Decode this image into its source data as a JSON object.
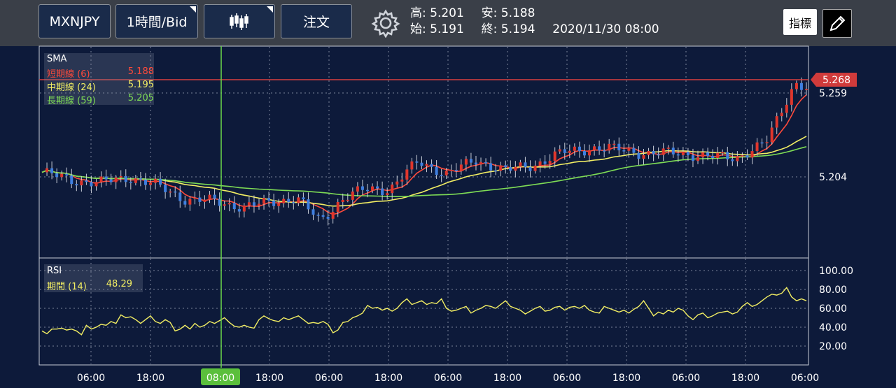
{
  "toolbar": {
    "symbol_label": "MXNJPY",
    "timeframe_label": "1時間/Bid",
    "order_label": "注文",
    "indicator_label": "指標",
    "settings_icon": "gear-icon",
    "candles_icon": "candlestick-icon",
    "draw_icon": "pencil-icon"
  },
  "ohlc": {
    "high_label": "高:",
    "high": "5.201",
    "low_label": "安:",
    "low": "5.188",
    "open_label": "始:",
    "open": "5.191",
    "close_label": "終:",
    "close": "5.194",
    "datetime": "2020/11/30 08:00"
  },
  "sma_legend": {
    "title": "SMA",
    "short_label": "短期線 (6)",
    "short_value": "5.188",
    "mid_label": "中期線 (24)",
    "mid_value": "5.195",
    "long_label": "長期線 (59)",
    "long_value": "5.205"
  },
  "rsi_legend": {
    "title": "RSI",
    "period_label": "期間 (14)",
    "period_value": "48.29"
  },
  "colors": {
    "background": "#0d1a3a",
    "up": "#e0362c",
    "down": "#3f7fe0",
    "sma_short": "#ff4a3a",
    "sma_mid": "#f2ee63",
    "sma_long": "#7edc55",
    "rsi": "#f2ee63",
    "crosshair": "#6cd94a",
    "price_line": "#d84040"
  },
  "chart_data": {
    "type": "candlestick",
    "price_axis": {
      "labels": [
        "5.259",
        "5.204"
      ],
      "values": [
        5.259,
        5.204
      ],
      "current_price": 5.268
    },
    "time_axis": {
      "labels": [
        "06:00",
        "18:00",
        "08:00",
        "18:00",
        "06:00",
        "18:00",
        "06:00",
        "18:00",
        "06:00",
        "18:00",
        "06:00",
        "18:00",
        "06:00"
      ],
      "highlighted": "08:00"
    },
    "rsi_axis": {
      "labels": [
        "100.00",
        "80.00",
        "60.00",
        "40.00",
        "20.00"
      ],
      "values": [
        100,
        80,
        60,
        40,
        20
      ]
    },
    "rsi_values": [
      36,
      33,
      38,
      38,
      39,
      37,
      38,
      36,
      32,
      42,
      38,
      40,
      43,
      42,
      46,
      44,
      53,
      50,
      51,
      48,
      44,
      48,
      52,
      46,
      44,
      48,
      45,
      36,
      38,
      42,
      38,
      44,
      40,
      42,
      46,
      44,
      47,
      50,
      45,
      41,
      40,
      42,
      40,
      39,
      48,
      52,
      49,
      47,
      46,
      50,
      48,
      50,
      52,
      48,
      44,
      45,
      44,
      46,
      43,
      34,
      37,
      45,
      46,
      50,
      52,
      55,
      63,
      60,
      61,
      58,
      60,
      57,
      60,
      66,
      70,
      64,
      66,
      68,
      64,
      66,
      65,
      70,
      60,
      57,
      58,
      60,
      62,
      55,
      58,
      60,
      63,
      62,
      60,
      64,
      68,
      62,
      60,
      58,
      54,
      57,
      60,
      62,
      57,
      58,
      61,
      62,
      58,
      61,
      62,
      60,
      63,
      58,
      56,
      55,
      62,
      60,
      58,
      56,
      58,
      55,
      59,
      62,
      68,
      60,
      52,
      56,
      54,
      58,
      56,
      60,
      58,
      52,
      48,
      53,
      55,
      50,
      52,
      55,
      56,
      57,
      54,
      56,
      62,
      66,
      62,
      64,
      68,
      72,
      75,
      74,
      76,
      82,
      72,
      68,
      70,
      68
    ]
  }
}
